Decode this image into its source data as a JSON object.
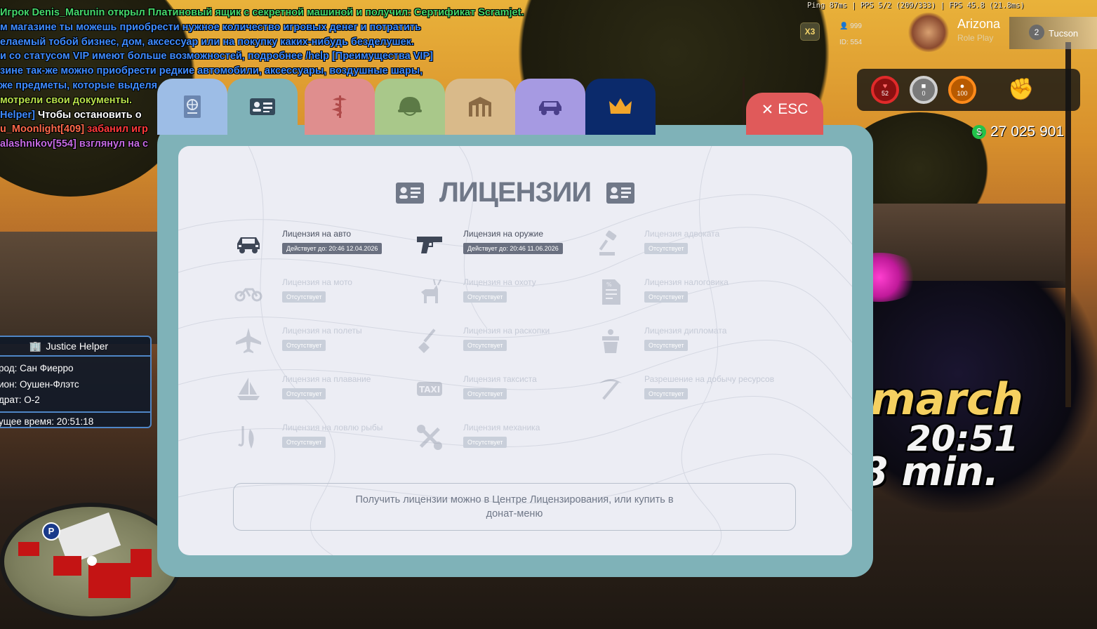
{
  "chat": [
    {
      "segments": [
        {
          "text": "Игрок Denis_Marunin открыл Платиновый ящик с секретной машиной и получил: Сертификат Scramjet.",
          "color": "#45d86a"
        }
      ]
    },
    {
      "segments": [
        {
          "text": "м магазине ты можешь приобрести нужное количество игровых денег и потратить",
          "color": "#3f8cff"
        }
      ]
    },
    {
      "segments": [
        {
          "text": "елаемый тобой бизнес, дом, аксессуар или на покупку каких-нибудь безделушек.",
          "color": "#3f8cff"
        }
      ]
    },
    {
      "segments": [
        {
          "text": "и со статусом VIP имеют больше возможностей, подробнее /help [Преимущества VIP]",
          "color": "#3f8cff"
        }
      ]
    },
    {
      "segments": [
        {
          "text": "зине так-же можно приобрести редкие автомобили, аксессуары, воздушные шары,",
          "color": "#3f8cff"
        }
      ]
    },
    {
      "segments": [
        {
          "text": "же предметы, которые выделя",
          "color": "#3f8cff"
        }
      ]
    },
    {
      "segments": [
        {
          "text": "мотрели свои документы.",
          "color": "#b8e04a"
        }
      ]
    },
    {
      "segments": [
        {
          "text": "Helper]",
          "color": "#3f8cff"
        },
        {
          "text": " Чтобы остановить о",
          "color": "#ffffff"
        }
      ]
    },
    {
      "segments": [
        {
          "text": "u_Moonlight[409]",
          "color": "#ff6a4a"
        },
        {
          "text": " забанил игр",
          "color": "#ff3a3a"
        }
      ]
    },
    {
      "segments": [
        {
          "text": "alashnikov[554] взглянул на с",
          "color": "#c46ae0"
        }
      ]
    }
  ],
  "hud": {
    "perf": "Ping  87ms  |  PPS  5/2  (209/333)  |  FPS  45.8 (21.8ms)",
    "multiplier": "X3",
    "online": "999",
    "player_id": "ID: 554",
    "logo_name": "Arizona",
    "logo_sub": "Role Play",
    "server_number": "2",
    "server_name": "Tucson",
    "health": "52",
    "armor": "0",
    "hunger": "100",
    "money": "27 025 901"
  },
  "helper": {
    "title": "Justice Helper",
    "city": "род: Сан Фиерро",
    "district": "ион: Оушен-Флэтс",
    "square": "драт: О-2",
    "time": "ущее время: 20:51:18"
  },
  "gametext": {
    "month": "march",
    "clock": "20:51",
    "minutes": "8 min."
  },
  "panel": {
    "esc_label": "ESC",
    "title": "ЛИЦЕНЗИИ",
    "tabs": [
      {
        "name": "globe",
        "color": "#9dbde6",
        "icon": "globe-icon"
      },
      {
        "name": "id-card",
        "color": "#7fb2b8",
        "icon": "id-card-icon",
        "active": true
      },
      {
        "name": "medicine",
        "color": "#df8e8e",
        "icon": "caduceus-icon"
      },
      {
        "name": "army",
        "color": "#a9c88a",
        "icon": "helmet-icon"
      },
      {
        "name": "property",
        "color": "#d9ba8a",
        "icon": "building-icon"
      },
      {
        "name": "vehicles",
        "color": "#a69ae2",
        "icon": "car-icon"
      },
      {
        "name": "donate",
        "color": "#0b2a6b",
        "icon": "crown-icon"
      }
    ],
    "licenses": [
      {
        "name": "Лицензия на авто",
        "status": "Действует до: 20:46 12.04.2026",
        "active": true,
        "icon": "car-icon"
      },
      {
        "name": "Лицензия на оружие",
        "status": "Действует до: 20:46 11.06.2026",
        "active": true,
        "icon": "pistol-icon"
      },
      {
        "name": "Лицензия адвоката",
        "status": "Отсутствует",
        "active": false,
        "icon": "gavel-icon"
      },
      {
        "name": "Лицензия на мото",
        "status": "Отсутствует",
        "active": false,
        "icon": "motorcycle-icon"
      },
      {
        "name": "Лицензия на охоту",
        "status": "Отсутствует",
        "active": false,
        "icon": "deer-icon"
      },
      {
        "name": "Лицензия налоговика",
        "status": "Отсутствует",
        "active": false,
        "icon": "tax-document-icon"
      },
      {
        "name": "Лицензия на полеты",
        "status": "Отсутствует",
        "active": false,
        "icon": "plane-icon"
      },
      {
        "name": "Лицензия на раскопки",
        "status": "Отсутствует",
        "active": false,
        "icon": "shovel-icon"
      },
      {
        "name": "Лицензия дипломата",
        "status": "Отсутствует",
        "active": false,
        "icon": "diplomat-icon"
      },
      {
        "name": "Лицензия на плавание",
        "status": "Отсутствует",
        "active": false,
        "icon": "sailboat-icon"
      },
      {
        "name": "Лицензия таксиста",
        "status": "Отсутствует",
        "active": false,
        "icon": "taxi-icon"
      },
      {
        "name": "Разрешение на добычу ресурсов",
        "status": "Отсутствует",
        "active": false,
        "icon": "pickaxe-icon"
      },
      {
        "name": "Лицензия на ловлю рыбы",
        "status": "Отсутствует",
        "active": false,
        "icon": "fish-hook-icon"
      },
      {
        "name": "Лицензия механика",
        "status": "Отсутствует",
        "active": false,
        "icon": "wrench-icon"
      }
    ],
    "note": "Получить лицензии можно в Центре Лицензирования, или купить в донат-меню"
  },
  "colors": {
    "frame": "#7fb2b8",
    "content_bg": "#ecedf4",
    "esc": "#e05a5a",
    "badge_active": "#6a7080",
    "badge_inactive": "#c9cfda",
    "money_icon": "#22c34a"
  }
}
